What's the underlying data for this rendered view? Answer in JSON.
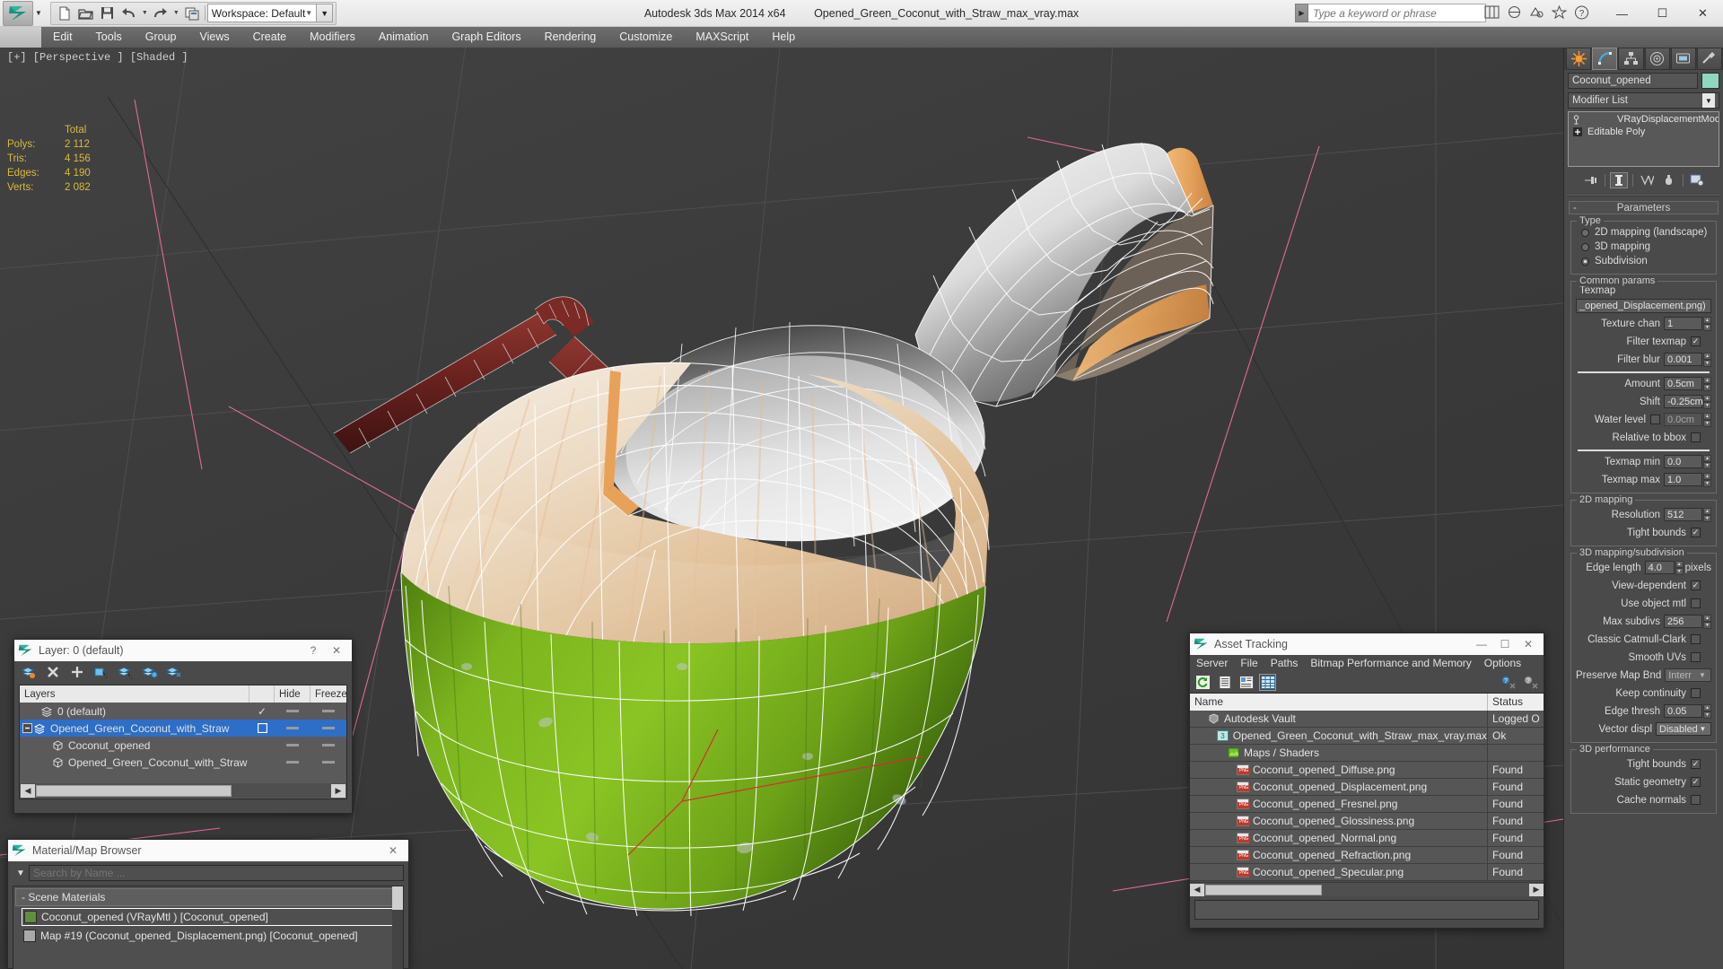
{
  "titlebar": {
    "workspace": "Workspace: Default",
    "app_title": "Autodesk 3ds Max  2014 x64",
    "file_title": "Opened_Green_Coconut_with_Straw_max_vray.max",
    "search_placeholder": "Type a keyword or phrase",
    "qat": [
      "new-icon",
      "open-icon",
      "save-icon",
      "undo-icon",
      "redo-icon",
      "set-project-icon"
    ],
    "window_buttons": [
      "minimize",
      "maximize",
      "close"
    ]
  },
  "menubar": {
    "items": [
      "Edit",
      "Tools",
      "Group",
      "Views",
      "Create",
      "Modifiers",
      "Animation",
      "Graph Editors",
      "Rendering",
      "Customize",
      "MAXScript",
      "Help"
    ]
  },
  "viewport": {
    "label": "[+] [Perspective ] [Shaded ]",
    "stats": {
      "header": "Total",
      "rows": [
        {
          "label": "Polys:",
          "value": "2 112"
        },
        {
          "label": "Tris:",
          "value": "4 156"
        },
        {
          "label": "Edges:",
          "value": "4 190"
        },
        {
          "label": "Verts:",
          "value": "2 082"
        }
      ]
    }
  },
  "command_panel": {
    "tabs": [
      "create-tab",
      "modify-tab",
      "hierarchy-tab",
      "motion-tab",
      "display-tab",
      "utilities-tab"
    ],
    "active_tab_index": 1,
    "object_name": "Coconut_opened",
    "object_color": "#8fd7c0",
    "modifier_list_label": "Modifier List",
    "stack": [
      {
        "label": "VRayDisplacementMod",
        "icon": "modifier-icon"
      },
      {
        "label": "Editable Poly",
        "icon": "plus-expand-icon"
      }
    ],
    "rollout_title": "Parameters",
    "type_group": {
      "title": "Type",
      "options": [
        "2D mapping (landscape)",
        "3D mapping",
        "Subdivision"
      ],
      "selected": "Subdivision"
    },
    "common_params": {
      "title": "Common params",
      "texmap_label": "Texmap",
      "texmap_value": "_opened_Displacement.png)",
      "texture_chan_label": "Texture chan",
      "texture_chan_value": "1",
      "filter_texmap_label": "Filter texmap",
      "filter_texmap_checked": true,
      "filter_blur_label": "Filter blur",
      "filter_blur_value": "0.001",
      "amount_label": "Amount",
      "amount_value": "0.5cm",
      "shift_label": "Shift",
      "shift_value": "-0.25cm",
      "water_level_label": "Water level",
      "water_level_checked": false,
      "water_level_value": "0.0cm",
      "relative_bbox_label": "Relative to bbox",
      "relative_bbox_checked": false,
      "texmap_min_label": "Texmap min",
      "texmap_min_value": "0.0",
      "texmap_max_label": "Texmap max",
      "texmap_max_value": "1.0"
    },
    "mapping2d": {
      "title": "2D mapping",
      "resolution_label": "Resolution",
      "resolution_value": "512",
      "tight_bounds_label": "Tight bounds",
      "tight_bounds_checked": true
    },
    "mapping3d": {
      "title": "3D mapping/subdivision",
      "edge_length_label": "Edge length",
      "edge_length_value": "4.0",
      "edge_length_units": "pixels",
      "view_dependent_label": "View-dependent",
      "view_dependent_checked": true,
      "use_object_mtl_label": "Use object mtl",
      "use_object_mtl_checked": false,
      "max_subdivs_label": "Max subdivs",
      "max_subdivs_value": "256",
      "classic_cc_label": "Classic Catmull-Clark",
      "classic_cc_checked": false,
      "smooth_uvs_label": "Smooth UVs",
      "smooth_uvs_checked": false,
      "preserve_map_label": "Preserve Map Bnd",
      "preserve_map_value": "Interr",
      "keep_continuity_label": "Keep continuity",
      "keep_continuity_checked": false,
      "edge_thresh_label": "Edge thresh",
      "edge_thresh_value": "0.05",
      "vector_displ_label": "Vector displ",
      "vector_displ_value": "Disabled"
    },
    "perf3d": {
      "title": "3D performance",
      "tight_bounds_label": "Tight bounds",
      "tight_bounds_checked": true,
      "static_geometry_label": "Static geometry",
      "static_geometry_checked": true,
      "cache_normals_label": "Cache normals",
      "cache_normals_checked": false
    }
  },
  "layer_dialog": {
    "title": "Layer: 0 (default)",
    "help_label": "?",
    "close_label": "✕",
    "toolbar": [
      "new-layer-icon",
      "delete-layer-icon",
      "add-layer-icon",
      "select-objects-icon",
      "select-highlighted-icon",
      "highlight-selected-icon",
      "hide-layer-icon"
    ],
    "columns": [
      "Layers",
      "",
      "Hide",
      "Freeze"
    ],
    "rows": [
      {
        "name": "0 (default)",
        "icon": "layer-icon",
        "indent": 1,
        "current": true,
        "hide": "-",
        "freeze": "-",
        "selected": false,
        "expander": ""
      },
      {
        "name": "Opened_Green_Coconut_with_Straw",
        "icon": "layer-icon",
        "indent": 0,
        "current": false,
        "hide": "-",
        "freeze": "-",
        "selected": true,
        "expander": "minus"
      },
      {
        "name": "Coconut_opened",
        "icon": "object-icon",
        "indent": 2,
        "current": false,
        "hide": "-",
        "freeze": "-",
        "selected": false,
        "expander": ""
      },
      {
        "name": "Opened_Green_Coconut_with_Straw",
        "icon": "object-icon",
        "indent": 2,
        "current": false,
        "hide": "-",
        "freeze": "-",
        "selected": false,
        "expander": ""
      }
    ]
  },
  "material_browser": {
    "title": "Material/Map Browser",
    "close_label": "✕",
    "search_placeholder": "Search by Name ...",
    "group_label": "- Scene Materials",
    "items": [
      {
        "label": "Coconut_opened  (VRayMtl ) [Coconut_opened]",
        "selected": true,
        "swatch": "#5f8f3a"
      },
      {
        "label": "Map #19 (Coconut_opened_Displacement.png) [Coconut_opened]",
        "selected": false,
        "swatch": "#a9a9a9"
      }
    ]
  },
  "asset_tracking": {
    "title": "Asset Tracking",
    "window_buttons": [
      "—",
      "☐",
      "✕"
    ],
    "menu": [
      "Server",
      "File",
      "Paths",
      "Bitmap Performance and Memory",
      "Options"
    ],
    "toolbar": [
      "refresh-icon",
      "list-view-icon",
      "detail-view-icon",
      "grid-view-icon"
    ],
    "toolbar_right": [
      "help-add-icon",
      "help-icon"
    ],
    "active_tool_index": 3,
    "columns": [
      "Name",
      "Status"
    ],
    "rows": [
      {
        "name": "Autodesk Vault",
        "status": "Logged O",
        "icon": "vault-icon",
        "indent": 1
      },
      {
        "name": "Opened_Green_Coconut_with_Straw_max_vray.max",
        "status": "Ok",
        "icon": "max-file-icon",
        "indent": 2
      },
      {
        "name": "Maps / Shaders",
        "status": "",
        "icon": "maps-icon",
        "indent": 3
      },
      {
        "name": "Coconut_opened_Diffuse.png",
        "status": "Found",
        "icon": "png-icon",
        "indent": 4
      },
      {
        "name": "Coconut_opened_Displacement.png",
        "status": "Found",
        "icon": "png-icon",
        "indent": 4
      },
      {
        "name": "Coconut_opened_Fresnel.png",
        "status": "Found",
        "icon": "png-icon",
        "indent": 4
      },
      {
        "name": "Coconut_opened_Glossiness.png",
        "status": "Found",
        "icon": "png-icon",
        "indent": 4
      },
      {
        "name": "Coconut_opened_Normal.png",
        "status": "Found",
        "icon": "png-icon",
        "indent": 4
      },
      {
        "name": "Coconut_opened_Refraction.png",
        "status": "Found",
        "icon": "png-icon",
        "indent": 4
      },
      {
        "name": "Coconut_opened_Specular.png",
        "status": "Found",
        "icon": "png-icon",
        "indent": 4
      }
    ]
  },
  "colors": {
    "accent_blue": "#2d6ec6",
    "stats_yellow": "#d9b93a",
    "coconut_green": "#6aa81c",
    "coconut_flesh": "#e8d2b4",
    "straw_red": "#6e2420"
  }
}
